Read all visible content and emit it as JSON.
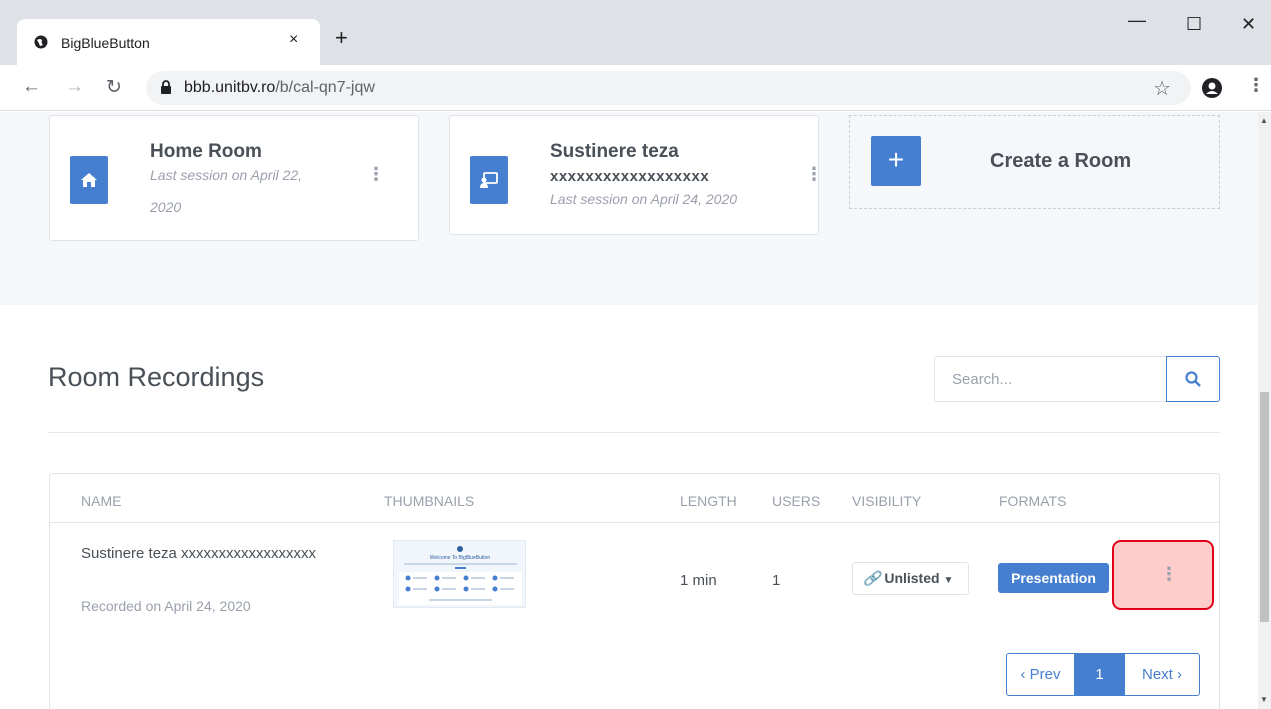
{
  "browser": {
    "tab_title": "BigBlueButton",
    "tab_close": "×",
    "new_tab": "+",
    "url_host": "bbb.unitbv.ro",
    "url_path": "/b/cal-qn7-jqw",
    "minimize": "—",
    "maximize": "☐",
    "close": "✕"
  },
  "rooms": [
    {
      "name": "Home Room",
      "sub1": "Last session on April 22,",
      "sub2": "2020",
      "icon": "home-icon"
    },
    {
      "name": "Sustinere teza",
      "code": "xxxxxxxxxxxxxxxxxx",
      "sub1": "Last session on April 24, 2020",
      "icon": "presentation-icon"
    }
  ],
  "create_room": {
    "label": "Create a Room"
  },
  "recordings": {
    "title": "Room Recordings",
    "search_placeholder": "Search...",
    "columns": [
      "NAME",
      "THUMBNAILS",
      "LENGTH",
      "USERS",
      "VISIBILITY",
      "FORMATS"
    ],
    "rows": [
      {
        "name": "Sustinere teza xxxxxxxxxxxxxxxxxx",
        "recorded": "Recorded on April 24, 2020",
        "thumbnail_title": "Welcome To BigBlueButton",
        "length": "1 min",
        "users": "1",
        "visibility": "Unlisted",
        "format": "Presentation"
      }
    ],
    "pagination": {
      "prev": "‹ Prev",
      "current": "1",
      "next": "Next ›"
    }
  },
  "colors": {
    "primary": "#467fcf",
    "highlight_fill": "#ffcccc",
    "highlight_border": "#e0001a"
  }
}
